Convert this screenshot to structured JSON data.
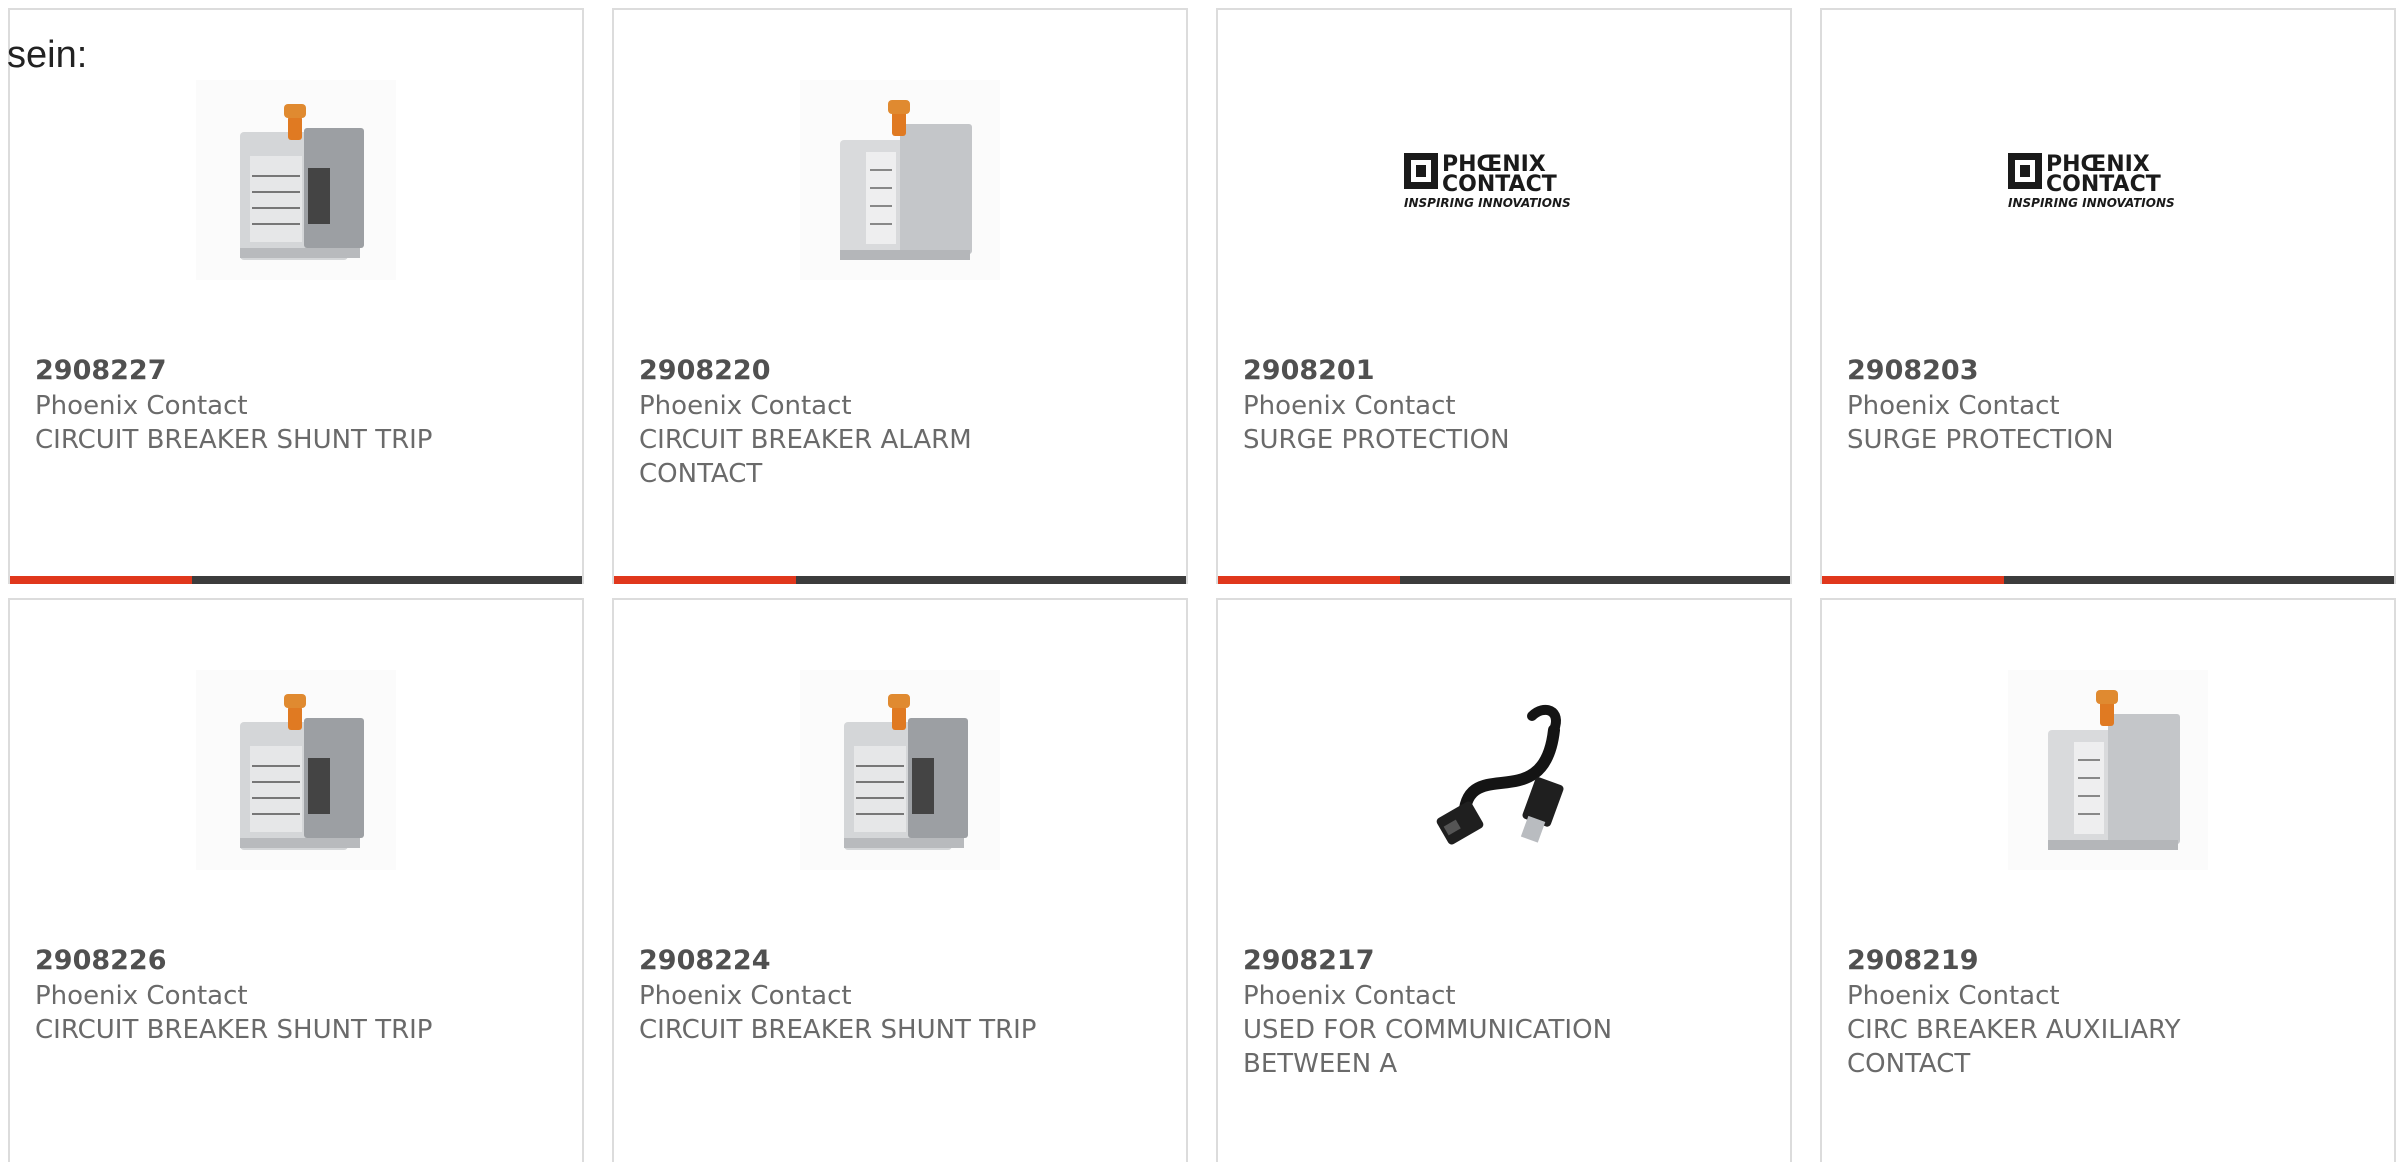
{
  "intro_text": "sein:",
  "colors": {
    "accent": "#e0371c",
    "bar": "#3c3c3c",
    "border": "#dcdcdc"
  },
  "products": [
    {
      "sku": "2908227",
      "brand": "Phoenix Contact",
      "desc": "CIRCUIT BREAKER SHUNT TRIP",
      "image": "circuit-breaker-photo"
    },
    {
      "sku": "2908220",
      "brand": "Phoenix Contact",
      "desc": "CIRCUIT BREAKER ALARM CONTACT",
      "image": "circuit-breaker-photo"
    },
    {
      "sku": "2908201",
      "brand": "Phoenix Contact",
      "desc": "SURGE PROTECTION",
      "image": "brand-logo"
    },
    {
      "sku": "2908203",
      "brand": "Phoenix Contact",
      "desc": "SURGE PROTECTION",
      "image": "brand-logo"
    },
    {
      "sku": "2908226",
      "brand": "Phoenix Contact",
      "desc": "CIRCUIT BREAKER SHUNT TRIP",
      "image": "circuit-breaker-photo"
    },
    {
      "sku": "2908224",
      "brand": "Phoenix Contact",
      "desc": "CIRCUIT BREAKER SHUNT TRIP",
      "image": "circuit-breaker-photo"
    },
    {
      "sku": "2908217",
      "brand": "Phoenix Contact",
      "desc": "USED FOR COMMUNICATION BETWEEN A",
      "image": "usb-cable-photo"
    },
    {
      "sku": "2908219",
      "brand": "Phoenix Contact",
      "desc": "CIRC BREAKER AUXILIARY CONTACT",
      "image": "circuit-breaker-photo"
    }
  ],
  "logo": {
    "line1": "PHŒNIX",
    "line2": "CONTACT",
    "tagline": "INSPIRING INNOVATIONS"
  }
}
